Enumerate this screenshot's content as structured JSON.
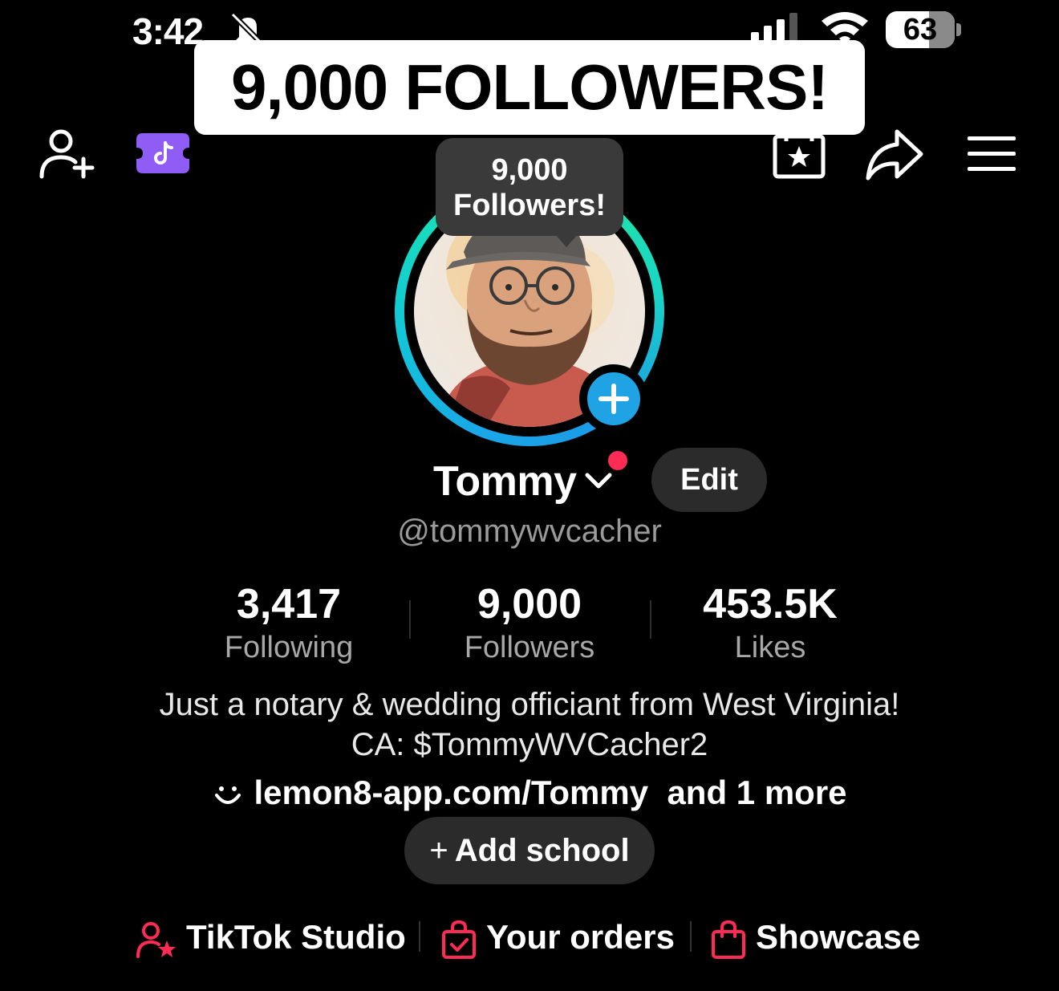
{
  "status_bar": {
    "time": "3:42",
    "battery_percent": "63",
    "battery_level": 0.63,
    "icons": [
      "bell-muted-icon",
      "signal-icon",
      "wifi-icon",
      "battery-icon"
    ]
  },
  "caption_banner": "9,000 FOLLOWERS!",
  "top_nav": {
    "icons": [
      "add-friend-icon",
      "ticket-icon",
      "calendar-star-icon",
      "share-icon",
      "menu-icon"
    ]
  },
  "tooltip": {
    "line1": "9,000",
    "line2": "Followers!"
  },
  "profile": {
    "display_name": "Tommy",
    "edit_label": "Edit",
    "handle": "@tommywvcacher"
  },
  "stats": [
    {
      "value": "3,417",
      "label": "Following"
    },
    {
      "value": "9,000",
      "label": "Followers"
    },
    {
      "value": "453.5K",
      "label": "Likes"
    }
  ],
  "bio": {
    "line1": "Just a notary & wedding officiant from West Virginia!",
    "line2": "CA: $TommyWVCacher2",
    "link": "lemon8-app.com/Tommy",
    "link_more": "and 1 more"
  },
  "add_school_label": "Add school",
  "tools": [
    {
      "label": "TikTok Studio",
      "icon": "studio-icon"
    },
    {
      "label": "Your orders",
      "icon": "orders-bag-icon"
    },
    {
      "label": "Showcase",
      "icon": "showcase-bag-icon"
    }
  ],
  "colors": {
    "background": "#000000",
    "accent_pink": "#fe2c55",
    "plus_blue": "#1fa3e4",
    "ticket_purple": "#8f5cf6",
    "ring_gradient": [
      "#1aa6e8",
      "#22e6a0"
    ]
  }
}
